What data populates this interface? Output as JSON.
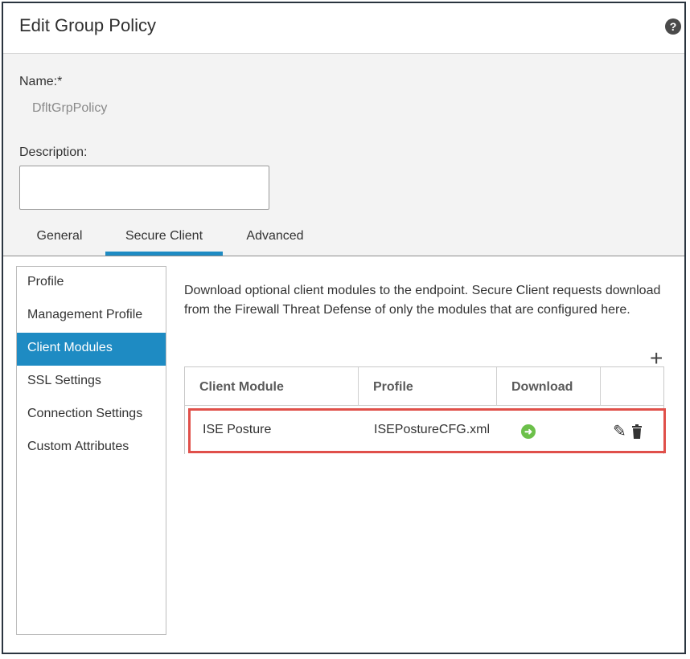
{
  "dialog": {
    "title": "Edit Group Policy",
    "help_icon": "help-circle-icon"
  },
  "form": {
    "name_label": "Name:*",
    "name_value": "DfltGrpPolicy",
    "description_label": "Description:",
    "description_value": ""
  },
  "tabs": [
    {
      "label": "General",
      "active": false
    },
    {
      "label": "Secure Client",
      "active": true
    },
    {
      "label": "Advanced",
      "active": false
    }
  ],
  "sidebar": {
    "items": [
      {
        "label": "Profile",
        "active": false
      },
      {
        "label": "Management Profile",
        "active": false
      },
      {
        "label": "Client Modules",
        "active": true
      },
      {
        "label": "SSL Settings",
        "active": false
      },
      {
        "label": "Connection Settings",
        "active": false
      },
      {
        "label": "Custom Attributes",
        "active": false
      }
    ]
  },
  "main": {
    "intro_text": "Download optional client modules to the endpoint. Secure Client requests download from the Firewall Threat Defense of only the modules that are configured here.",
    "add_icon": "plus-icon",
    "table": {
      "columns": [
        "Client Module",
        "Profile",
        "Download",
        ""
      ],
      "rows": [
        {
          "module": "ISE Posture",
          "profile": "ISEPostureCFG.xml",
          "download_icon": "arrow-right-circle-icon",
          "actions": [
            "pencil-icon",
            "trash-icon"
          ]
        }
      ]
    }
  },
  "colors": {
    "accent": "#1e8bc3",
    "highlight": "#e0504a",
    "download_green": "#6cc04a"
  }
}
